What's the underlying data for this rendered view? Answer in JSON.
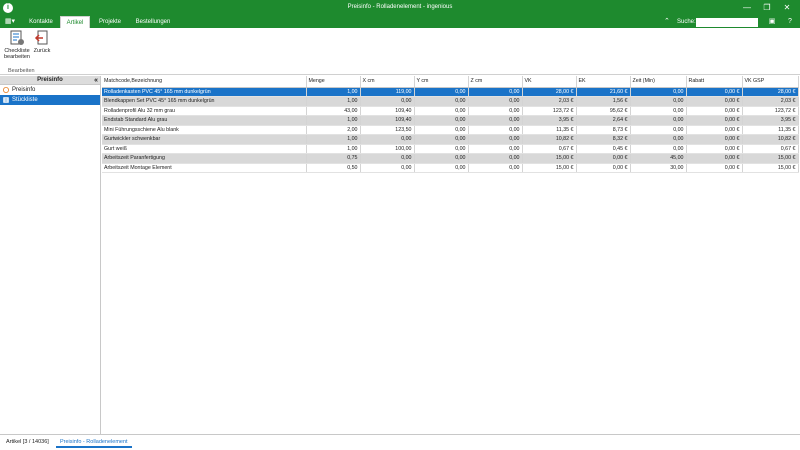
{
  "window": {
    "title": "Preisinfo - Rolladenelement - ingenious",
    "minimize": "—",
    "restore": "❐",
    "close": "✕"
  },
  "tabs": [
    {
      "label": "Kontakte"
    },
    {
      "label": "Artikel"
    },
    {
      "label": "Projekte"
    },
    {
      "label": "Bestellungen"
    }
  ],
  "search": {
    "label": "Suche:",
    "value": ""
  },
  "ribbon": {
    "checklist_label": "Checkliste\nbearbeiten",
    "back_label": "Zurück",
    "group_label": "Bearbeiten"
  },
  "sidebar": {
    "title": "Preisinfo",
    "items": [
      {
        "label": "Preisinfo"
      },
      {
        "label": "Stückliste"
      }
    ]
  },
  "table": {
    "columns": [
      "Matchcode,Bezeichnung",
      "Menge",
      "X cm",
      "Y cm",
      "Z cm",
      "VK",
      "EK",
      "Zeit (Min)",
      "Rabatt",
      "VK GSP"
    ],
    "rows": [
      [
        "Rolladenkasten PVC 45° 165 mm dunkelgrün",
        "1,00",
        "119,00",
        "0,00",
        "0,00",
        "28,00 €",
        "21,60 €",
        "0,00",
        "0,00 €",
        "28,00 €"
      ],
      [
        "Blendkappen Set PVC 45° 165 mm dunkelgrün",
        "1,00",
        "0,00",
        "0,00",
        "0,00",
        "2,03 €",
        "1,56 €",
        "0,00",
        "0,00 €",
        "2,03 €"
      ],
      [
        "Rolladenprofil Alu 32 mm grau",
        "43,00",
        "109,40",
        "0,00",
        "0,00",
        "123,72 €",
        "95,62 €",
        "0,00",
        "0,00 €",
        "123,72 €"
      ],
      [
        "Endstab Standard Alu grau",
        "1,00",
        "109,40",
        "0,00",
        "0,00",
        "3,95 €",
        "2,64 €",
        "0,00",
        "0,00 €",
        "3,95 €"
      ],
      [
        "Mini Führungsschiene Alu blank",
        "2,00",
        "123,50",
        "0,00",
        "0,00",
        "11,35 €",
        "8,73 €",
        "0,00",
        "0,00 €",
        "11,35 €"
      ],
      [
        "Gurtwickler schwenkbar",
        "1,00",
        "0,00",
        "0,00",
        "0,00",
        "10,82 €",
        "8,32 €",
        "0,00",
        "0,00 €",
        "10,82 €"
      ],
      [
        "Gurt weiß",
        "1,00",
        "100,00",
        "0,00",
        "0,00",
        "0,67 €",
        "0,45 €",
        "0,00",
        "0,00 €",
        "0,67 €"
      ],
      [
        "Arbeitszeit Paranfertigung",
        "0,75",
        "0,00",
        "0,00",
        "0,00",
        "15,00 €",
        "0,00 €",
        "45,00",
        "0,00 €",
        "15,00 €"
      ],
      [
        "Arbeitszeit Montage Element",
        "0,50",
        "0,00",
        "0,00",
        "0,00",
        "15,00 €",
        "0,00 €",
        "30,00",
        "0,00 €",
        "15,00 €"
      ]
    ]
  },
  "bottom_tabs": [
    {
      "label": "Artikel [3 / 14036]"
    },
    {
      "label": "Preisinfo - Rolladenelement"
    }
  ],
  "colors": {
    "brand": "#1e8a2e",
    "selection": "#1a73c8"
  }
}
